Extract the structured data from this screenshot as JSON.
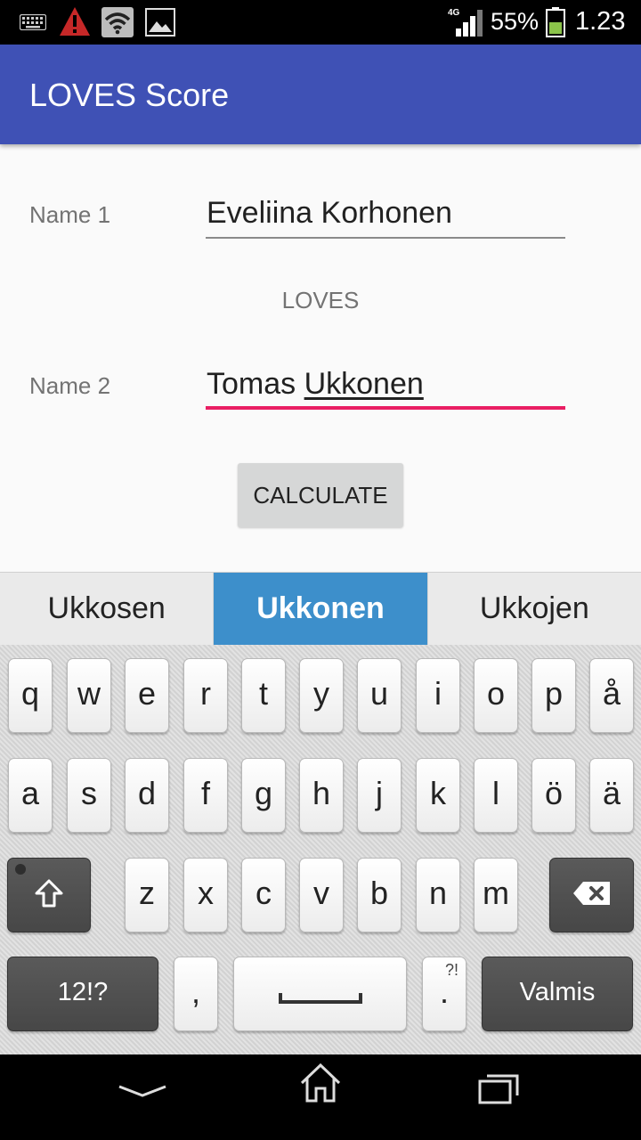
{
  "status_bar": {
    "battery_percent": "55%",
    "clock": "1.23",
    "network": "4G",
    "icons": [
      "keyboard-icon",
      "alert-icon",
      "wifi-icon",
      "image-icon",
      "signal-icon",
      "battery-icon"
    ]
  },
  "app_bar": {
    "title": "LOVES Score",
    "color": "#3f51b5"
  },
  "form": {
    "name1_label": "Name 1",
    "name1_value": "Eveliina Korhonen",
    "loves_label": "LOVES",
    "name2_label": "Name 2",
    "name2_first": "Tomas ",
    "name2_last": "Ukkonen",
    "calculate_label": "CALCULATE",
    "accent": "#e91e63"
  },
  "suggestions": {
    "items": [
      "Ukkosen",
      "Ukkonen",
      "Ukkojen"
    ],
    "selected_index": 1
  },
  "keyboard": {
    "row1": [
      "q",
      "w",
      "e",
      "r",
      "t",
      "y",
      "u",
      "i",
      "o",
      "p",
      "å"
    ],
    "row2": [
      "a",
      "s",
      "d",
      "f",
      "g",
      "h",
      "j",
      "k",
      "l",
      "ö",
      "ä"
    ],
    "row3": [
      "z",
      "x",
      "c",
      "v",
      "b",
      "n",
      "m"
    ],
    "symbols_label": "12!?",
    "comma": ",",
    "period": ".",
    "period_alt": "?!",
    "done_label": "Valmis"
  },
  "nav_bar": {
    "icons": [
      "back-icon",
      "home-icon",
      "recent-apps-icon"
    ]
  }
}
